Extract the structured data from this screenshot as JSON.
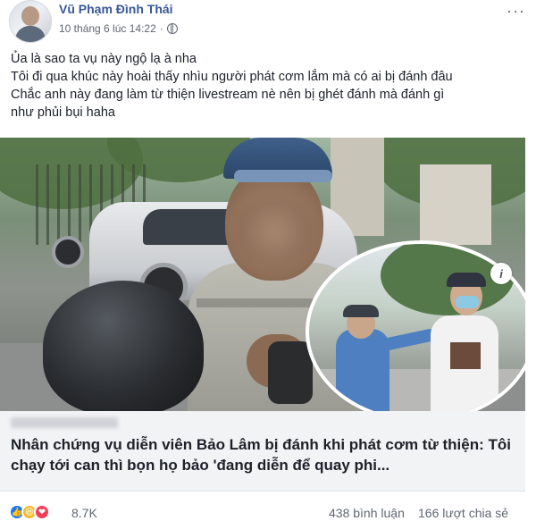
{
  "post": {
    "author": "Vũ Phạm Đình Thái",
    "timestamp": "10 tháng 6 lúc 14:22",
    "separator": "·",
    "privacy_icon": "globe-icon",
    "more_label": "···",
    "text_lines": [
      "Ủa là sao ta vụ này ngộ lạ à nha",
      "Tôi đi qua khúc này hoài thấy nhìu người phát cơm lắm mà có ai bị đánh đâu",
      "Chắc anh này đang làm từ thiện livestream nè nên bị ghét đánh mà đánh gì",
      "như phủi bụi haha"
    ]
  },
  "link_preview": {
    "title": "Nhân chứng vụ diễn viên Bảo Lâm bị đánh khi phát cơm từ thiện: Tôi chạy tới can thì bọn họ bảo 'đang diễn để quay phi...",
    "info_label": "i"
  },
  "footer": {
    "reactions": [
      "like-icon",
      "haha-icon",
      "love-icon"
    ],
    "reaction_count": "8.7K",
    "comment_count": "438 bình luận",
    "share_count": "166 lượt chia sẻ"
  }
}
